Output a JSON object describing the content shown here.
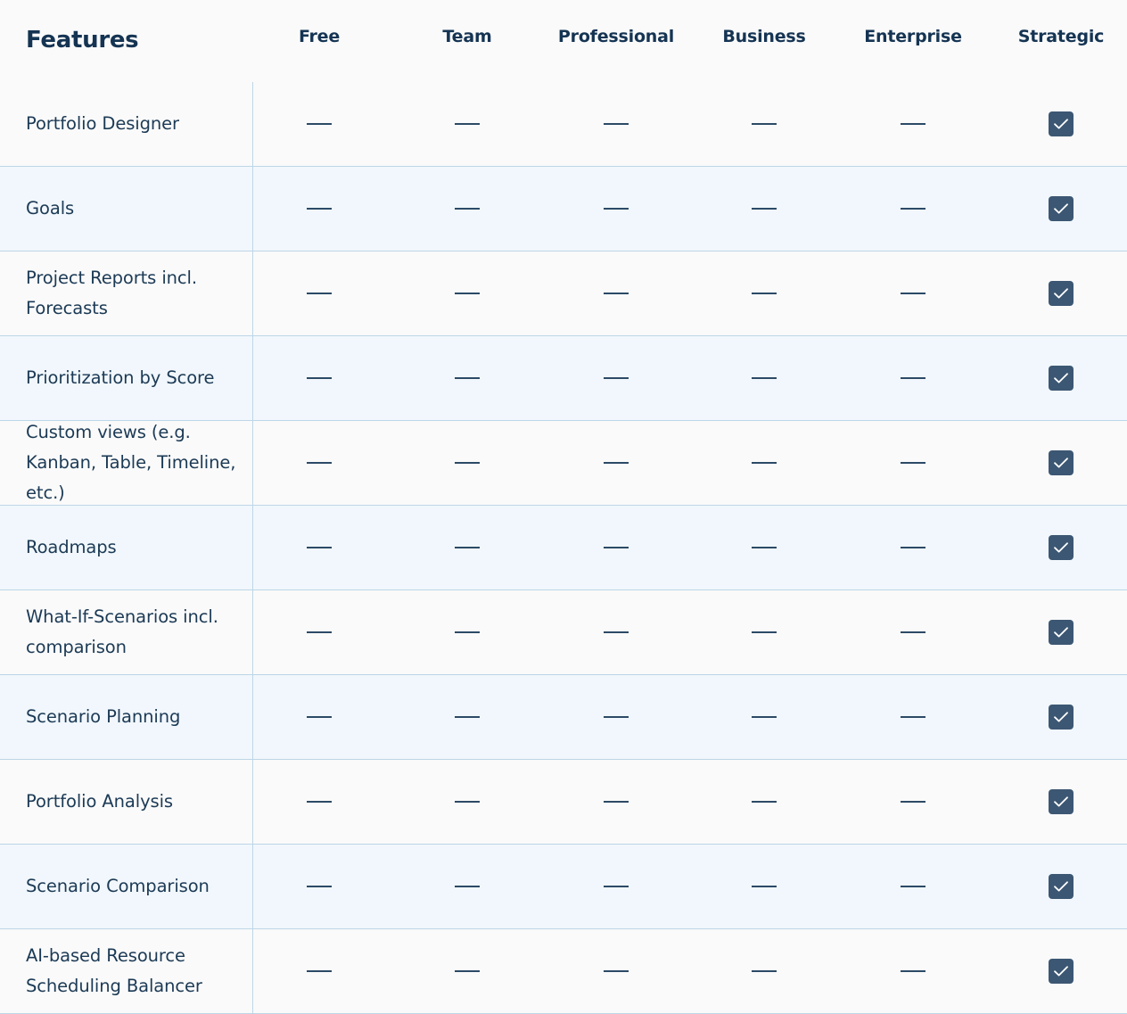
{
  "header": {
    "features_label": "Features",
    "plans": [
      "Free",
      "Team",
      "Professional",
      "Business",
      "Enterprise",
      "Strategic"
    ]
  },
  "icons": {
    "not_included": "dash-icon",
    "included": "checkbox-checked-icon"
  },
  "colors": {
    "text": "#1c3a55",
    "header_text": "#153453",
    "check_fill": "#3c5773",
    "row_alt": "#f1f7fc",
    "row_base": "#fafafa",
    "divider": "#bdd6e8"
  },
  "rows": [
    {
      "feature": "Portfolio Designer",
      "availability": [
        false,
        false,
        false,
        false,
        false,
        true
      ]
    },
    {
      "feature": "Goals",
      "availability": [
        false,
        false,
        false,
        false,
        false,
        true
      ]
    },
    {
      "feature": "Project Reports incl. Forecasts",
      "availability": [
        false,
        false,
        false,
        false,
        false,
        true
      ]
    },
    {
      "feature": "Prioritization by Score",
      "availability": [
        false,
        false,
        false,
        false,
        false,
        true
      ]
    },
    {
      "feature": "Custom views (e.g. Kanban, Table, Timeline, etc.)",
      "availability": [
        false,
        false,
        false,
        false,
        false,
        true
      ]
    },
    {
      "feature": "Roadmaps",
      "availability": [
        false,
        false,
        false,
        false,
        false,
        true
      ]
    },
    {
      "feature": "What-If-Scenarios incl. comparison",
      "availability": [
        false,
        false,
        false,
        false,
        false,
        true
      ]
    },
    {
      "feature": "Scenario Planning",
      "availability": [
        false,
        false,
        false,
        false,
        false,
        true
      ]
    },
    {
      "feature": "Portfolio Analysis",
      "availability": [
        false,
        false,
        false,
        false,
        false,
        true
      ]
    },
    {
      "feature": "Scenario Comparison",
      "availability": [
        false,
        false,
        false,
        false,
        false,
        true
      ]
    },
    {
      "feature": "AI-based Resource Scheduling Balancer",
      "availability": [
        false,
        false,
        false,
        false,
        false,
        true
      ]
    }
  ]
}
